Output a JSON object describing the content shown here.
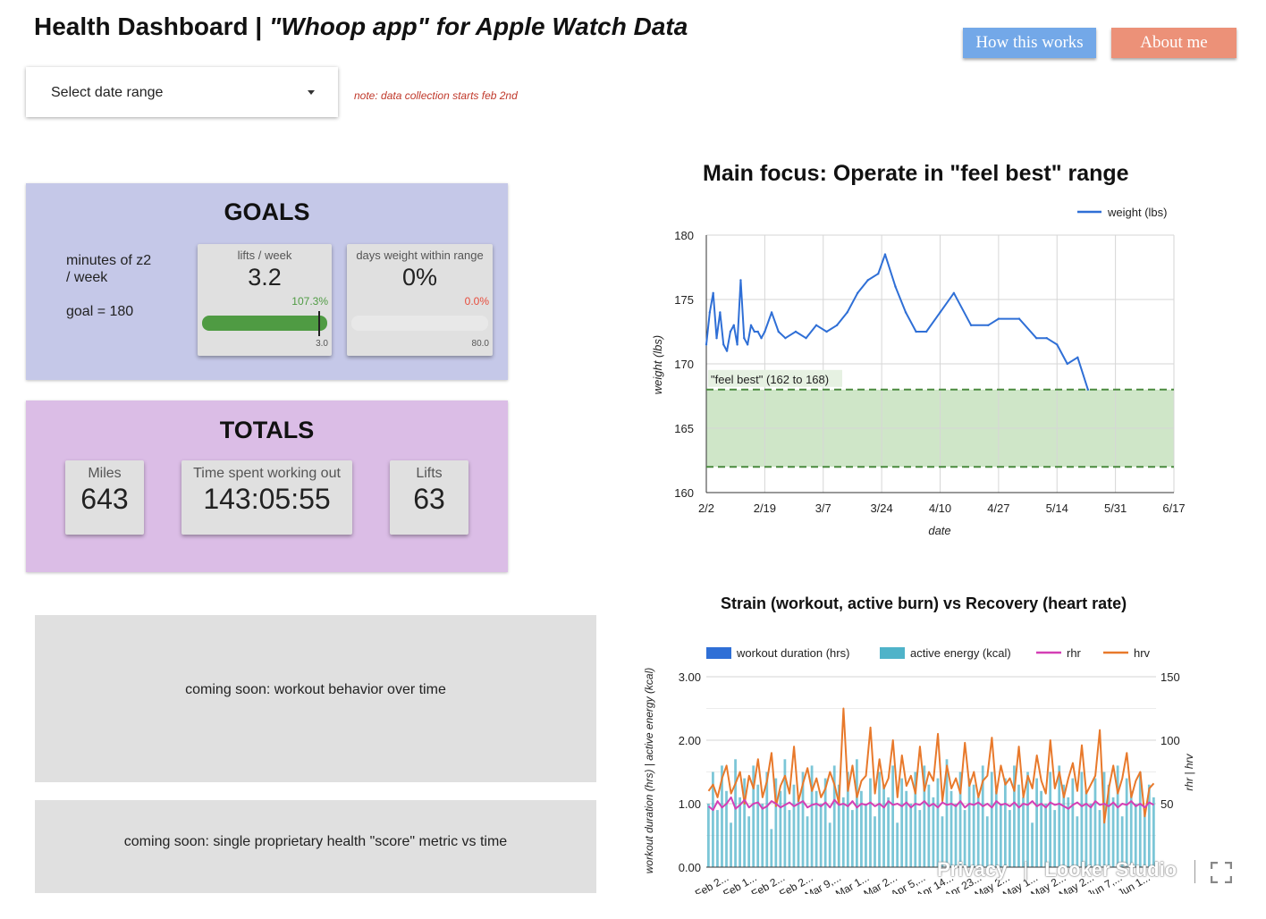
{
  "header": {
    "title_plain": "Health Dashboard | ",
    "title_italic": "\"Whoop app\" for Apple Watch Data",
    "how_button": "How this works",
    "about_button": "About me",
    "colors": {
      "how": "#73a8e8",
      "about": "#ec9178"
    }
  },
  "date_select": {
    "label": "Select date range",
    "icon": "dropdown-arrow-icon"
  },
  "note": "note: data collection starts feb 2nd",
  "goals": {
    "title": "GOALS",
    "z2_label_line1": "minutes of z2",
    "z2_label_line2": "/ week",
    "z2_goal": "goal = 180",
    "lifts": {
      "label": "lifts / week",
      "value": "3.2",
      "pct": "107.3%",
      "target": "3.0",
      "progress": 1.0,
      "color": "#4f9b43"
    },
    "weight": {
      "label": "days weight within range",
      "value": "0%",
      "pct": "0.0%",
      "target": "80.0",
      "progress": 0.0,
      "color": "#e74c3c"
    },
    "bg": "#c5c8e8"
  },
  "totals": {
    "title": "TOTALS",
    "miles_label": "Miles",
    "miles_value": "643",
    "time_label": "Time spent working out",
    "time_value": "143:05:55",
    "lifts_label": "Lifts",
    "lifts_value": "63",
    "bg": "#dbbde6"
  },
  "coming_soon": {
    "workout": "coming soon: workout behavior over time",
    "score": "coming soon: single proprietary health \"score\" metric vs time"
  },
  "footer": {
    "privacy": "Privacy",
    "separator": "|",
    "brand": "Looker Studio",
    "fullscreen_icon": "fullscreen-icon"
  },
  "chart_data": [
    {
      "type": "line",
      "title": "Main focus: Operate in \"feel best\" range",
      "xlabel": "date",
      "ylabel": "weight (lbs)",
      "ylim": [
        160,
        180
      ],
      "x_ticks": [
        "2/2",
        "2/19",
        "3/7",
        "3/24",
        "4/10",
        "4/27",
        "5/14",
        "5/31",
        "6/17"
      ],
      "y_ticks": [
        "160",
        "165",
        "170",
        "175",
        "180"
      ],
      "grid": true,
      "legend_position": "top-right",
      "band": {
        "label": "\"feel best\" (162 to 168)",
        "low": 162,
        "high": 168,
        "color": "#cfe6c8",
        "line_color": "#4a8a3f"
      },
      "series": [
        {
          "name": "weight (lbs)",
          "color": "#2f6fd6",
          "x": [
            "2/2",
            "2/3",
            "2/4",
            "2/5",
            "2/6",
            "2/7",
            "2/8",
            "2/9",
            "2/10",
            "2/11",
            "2/12",
            "2/13",
            "2/14",
            "2/15",
            "2/16",
            "2/17",
            "2/18",
            "2/19",
            "2/21",
            "2/23",
            "2/25",
            "2/28",
            "3/2",
            "3/5",
            "3/8",
            "3/11",
            "3/14",
            "3/17",
            "3/20",
            "3/23",
            "3/25",
            "3/28",
            "3/31",
            "4/3",
            "4/6",
            "4/10",
            "4/14",
            "4/19",
            "4/24",
            "4/27",
            "5/3",
            "5/8",
            "5/11",
            "5/14",
            "5/17",
            "5/20",
            "5/23"
          ],
          "values": [
            171.5,
            174,
            175.5,
            172,
            174,
            171.5,
            171,
            172.5,
            173,
            171.5,
            176.5,
            172,
            171.5,
            173,
            172.5,
            172.5,
            172,
            172.5,
            174,
            172.5,
            172,
            172.5,
            172,
            173,
            172.5,
            173,
            174,
            175.5,
            176.5,
            177,
            178.5,
            176,
            174,
            172.5,
            172.5,
            174,
            175.5,
            173,
            173,
            173.5,
            173.5,
            172,
            172,
            171.5,
            170,
            170.5,
            168
          ]
        }
      ]
    },
    {
      "type": "bar",
      "title": "Strain (workout, active burn) vs Recovery (heart rate)",
      "ylabel_left": "workout duration (hrs) | active energy (kcal)",
      "ylabel_right": "rhr | hrv",
      "y_left_ticks": [
        "0.00",
        "1.00",
        "2.00",
        "3.00"
      ],
      "y_right_ticks": [
        "50",
        "100",
        "150"
      ],
      "ylim_left": [
        0,
        3
      ],
      "ylim_right": [
        0,
        150
      ],
      "legend_position": "top",
      "x_ticks": [
        "Feb 2...",
        "Feb 1...",
        "Feb 2...",
        "Feb 2...",
        "Mar 9,...",
        "Mar 1...",
        "Mar 2...",
        "Apr 5,...",
        "Apr 14...",
        "Apr 23...",
        "May 2...",
        "May 1...",
        "May 2...",
        "May 2...",
        "Jun 7,...",
        "Jun 1..."
      ],
      "series": [
        {
          "name": "workout duration (hrs)",
          "color": "#2f6fd6"
        },
        {
          "name": "active energy (kcal)",
          "color": "#4fb3c9",
          "values": [
            1.0,
            1.5,
            0.9,
            1.6,
            1.2,
            0.7,
            1.7,
            1.1,
            1.4,
            0.8,
            1.6,
            1.3,
            1.0,
            1.5,
            0.6,
            1.4,
            1.2,
            1.7,
            0.9,
            1.3,
            1.1,
            1.5,
            0.8,
            1.6,
            1.2,
            1.0,
            1.4,
            0.7,
            1.6,
            1.3,
            1.1,
            1.5,
            0.9,
            1.7,
            1.2,
            1.0,
            1.4,
            0.8,
            1.5,
            1.3,
            1.1,
            1.6,
            0.7,
            1.4,
            1.2,
            1.0,
            1.5,
            0.9,
            1.6,
            1.3,
            1.1,
            1.4,
            0.8,
            1.7,
            1.2,
            1.0,
            1.5,
            0.9,
            1.4,
            1.3,
            1.1,
            1.6,
            0.8,
            1.5,
            1.2,
            1.0,
            1.4,
            0.9,
            1.6,
            1.3,
            1.1,
            1.5,
            0.7,
            1.4,
            1.2,
            1.0,
            1.5,
            0.9,
            1.6,
            1.3,
            1.1,
            1.4,
            0.8,
            1.5,
            1.2,
            1.0,
            1.4,
            0.9,
            1.5,
            1.3,
            1.1,
            1.6,
            0.8,
            1.4,
            1.2,
            1.0,
            1.5,
            0.9,
            1.3,
            1.1
          ]
        },
        {
          "name": "rhr",
          "color": "#d43fb5",
          "values": [
            48,
            45,
            52,
            47,
            50,
            55,
            46,
            49,
            53,
            47,
            50,
            51,
            46,
            48,
            52,
            50,
            47,
            49,
            51,
            48,
            50,
            52,
            47,
            49,
            50,
            48,
            51,
            47,
            53,
            49,
            50,
            48,
            52,
            47,
            50,
            49,
            51,
            48,
            50,
            47,
            52,
            49,
            50,
            48,
            51,
            47,
            50,
            49,
            52,
            48,
            50,
            47,
            51,
            49,
            50,
            48,
            52,
            47,
            50,
            49,
            51,
            48,
            50,
            47,
            52,
            49,
            50,
            48,
            51,
            47,
            50,
            49,
            52,
            48,
            50,
            47,
            51,
            49,
            50,
            48,
            46,
            49,
            51,
            48,
            50,
            47,
            52,
            49,
            50,
            48,
            51,
            47,
            50,
            49,
            52,
            48,
            50,
            47,
            51,
            49
          ]
        },
        {
          "name": "hrv",
          "color": "#e8792b",
          "values": [
            60,
            65,
            55,
            70,
            80,
            58,
            66,
            75,
            50,
            72,
            62,
            85,
            55,
            68,
            90,
            48,
            64,
            72,
            58,
            95,
            52,
            66,
            78,
            60,
            70,
            55,
            62,
            75,
            65,
            50,
            125,
            60,
            80,
            55,
            68,
            72,
            110,
            58,
            85,
            62,
            70,
            100,
            55,
            88,
            64,
            72,
            58,
            95,
            60,
            75,
            68,
            105,
            52,
            80,
            62,
            70,
            58,
            98,
            64,
            75,
            55,
            68,
            72,
            102,
            58,
            80,
            65,
            70,
            60,
            95,
            55,
            72,
            62,
            88,
            68,
            58,
            100,
            62,
            75,
            55,
            70,
            82,
            60,
            96,
            58,
            65,
            72,
            108,
            35,
            62,
            80,
            58,
            70,
            90,
            55,
            68,
            75,
            40,
            62,
            66
          ]
        }
      ]
    }
  ]
}
